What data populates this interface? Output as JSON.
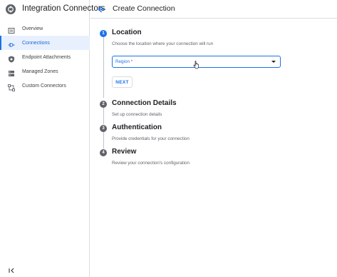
{
  "app": {
    "title": "Integration Connectors"
  },
  "header": {
    "title": "Create Connection",
    "back_icon": "arrow-left-icon"
  },
  "sidebar": {
    "items": [
      {
        "label": "Overview",
        "icon": "overview-icon",
        "active": false
      },
      {
        "label": "Connections",
        "icon": "connections-icon",
        "active": true
      },
      {
        "label": "Endpoint Attachments",
        "icon": "shield-icon",
        "active": false
      },
      {
        "label": "Managed Zones",
        "icon": "dns-icon",
        "active": false
      },
      {
        "label": "Custom Connectors",
        "icon": "custom-connector-icon",
        "active": false
      }
    ],
    "collapse_icon": "collapse-sidebar-icon"
  },
  "stepper": {
    "steps": [
      {
        "number": "1",
        "title": "Location",
        "subtitle": "Choose the location where your connection will run",
        "state": "current"
      },
      {
        "number": "2",
        "title": "Connection Details",
        "subtitle": "Set up connection details",
        "state": "pending"
      },
      {
        "number": "3",
        "title": "Authentication",
        "subtitle": "Provide credentials for your connection",
        "state": "pending"
      },
      {
        "number": "4",
        "title": "Review",
        "subtitle": "Review your connection's configuration",
        "state": "pending"
      }
    ]
  },
  "form": {
    "region": {
      "label": "Region",
      "required_mark": "*",
      "value": ""
    },
    "next_label": "NEXT"
  },
  "colors": {
    "accent": "#1a73e8",
    "active_bg": "#e8f0fe",
    "step_pending": "#5f6368"
  }
}
